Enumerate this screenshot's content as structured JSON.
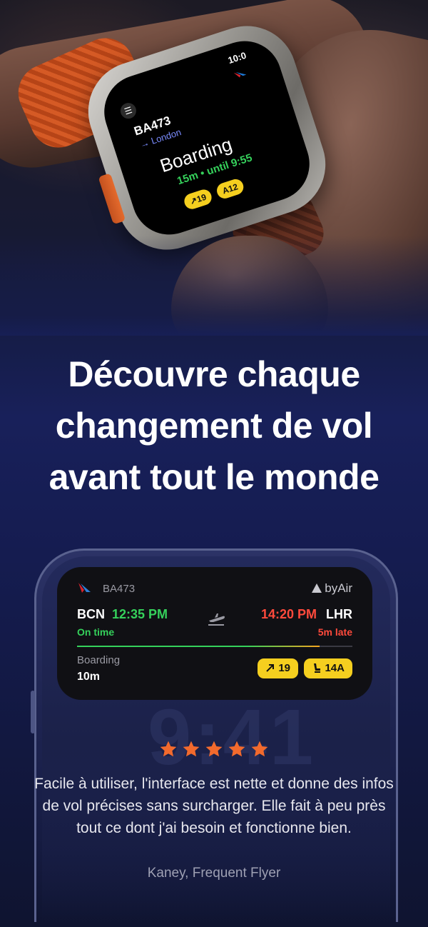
{
  "watch": {
    "time": "10:0",
    "menu_icon": "list-icon",
    "flight": "BA473",
    "destination": "→ London",
    "status": "Boarding",
    "countdown": "15m • until 9:55",
    "gate_chip": "↗19",
    "seat_chip": "A12"
  },
  "headline": "Découvre chaque changement de vol avant tout le monde",
  "live_activity": {
    "flight": "BA473",
    "brand": "byAir",
    "departure": {
      "code": "BCN",
      "time": "12:35 PM",
      "status": "On time"
    },
    "arrival": {
      "time": "14:20 PM",
      "code": "LHR",
      "status": "5m late"
    },
    "progress": 0.88,
    "boarding_label": "Boarding",
    "boarding_value": "10m",
    "gate": "19",
    "seat": "14A",
    "colors": {
      "on_time": "#35d15b",
      "late": "#ff4a3c",
      "chip": "#f5cf1f"
    }
  },
  "rating": {
    "stars": 5,
    "star_color": "#f26a2d"
  },
  "review": {
    "text": "Facile à utiliser, l'interface est nette et donne des infos de vol précises sans surcharger. Elle fait à peu près tout ce dont j'ai besoin et fonctionne bien.",
    "author": "Kaney, Frequent Flyer"
  }
}
